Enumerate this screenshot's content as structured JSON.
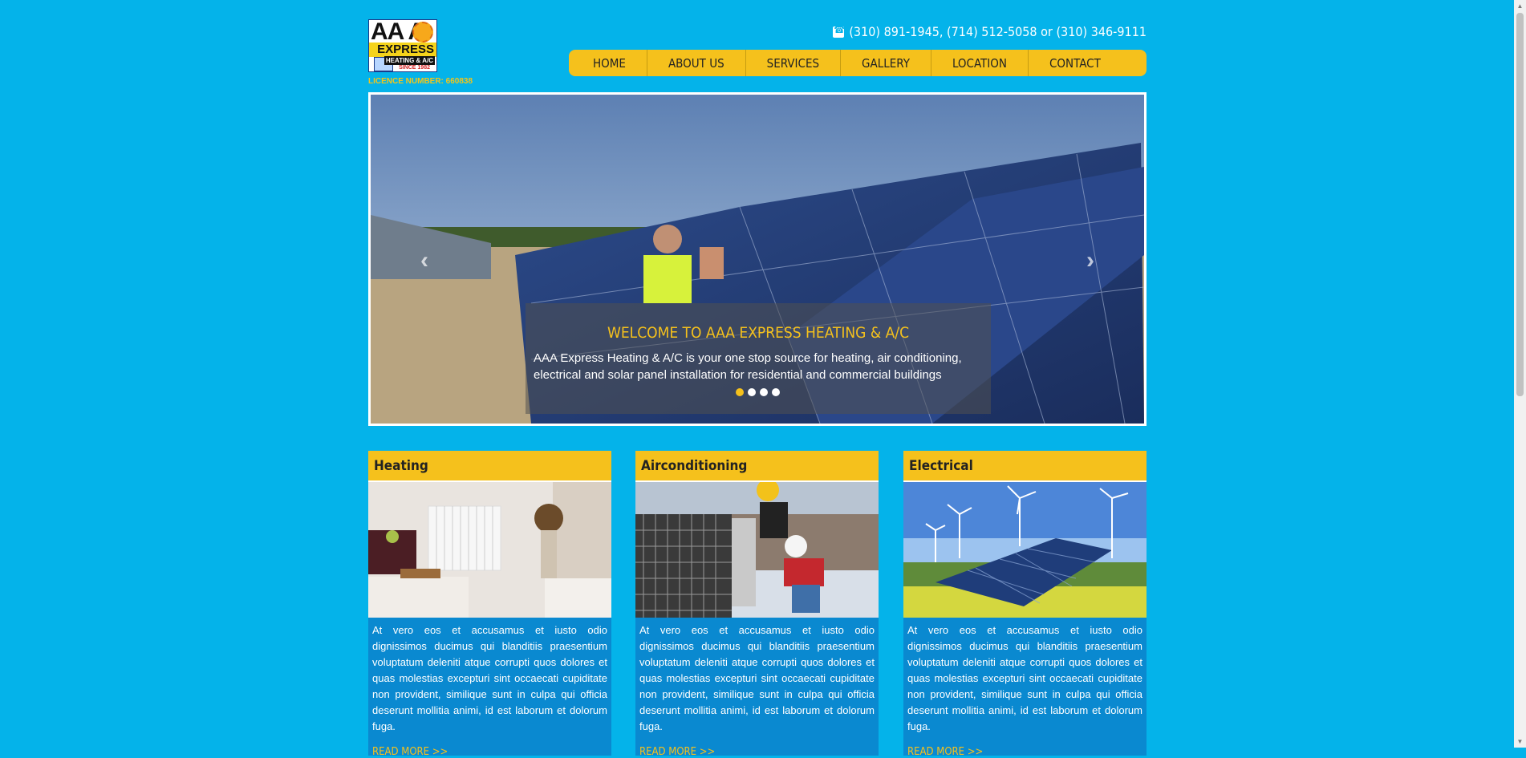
{
  "header": {
    "logo": {
      "text_aaa": "AA A",
      "text_express": "EXPRESS",
      "text_heating": "HEATING & A/C",
      "text_since": "SINCE 1982"
    },
    "licence": "LICENCE NUMBER: 660838",
    "phone": "(310) 891-1945, (714) 512-5058 or (310) 346-9111"
  },
  "nav": {
    "items": [
      "HOME",
      "ABOUT US",
      "SERVICES",
      "GALLERY",
      "LOCATION",
      "CONTACT"
    ]
  },
  "slider": {
    "title": "WELCOME TO AAA EXPRESS HEATING & A/C",
    "text": "AAA Express Heating & A/C is your one stop source for heating, air conditioning, electrical and solar panel installation for residential and commercial buildings",
    "prev": "‹",
    "next": "›",
    "dots": 4,
    "active_dot": 1
  },
  "cards": [
    {
      "title": "Heating",
      "text": "At vero eos et accusamus et iusto odio dignissimos ducimus qui blanditiis praesentium voluptatum deleniti atque corrupti quos dolores et quas molestias excepturi sint occaecati cupiditate non provident, similique sunt in culpa qui officia deserunt mollitia animi, id est laborum et dolorum fuga.",
      "read_more": "READ MORE >>"
    },
    {
      "title": "Airconditioning",
      "text": "At vero eos et accusamus et iusto odio dignissimos ducimus qui blanditiis praesentium voluptatum deleniti atque corrupti quos dolores et quas molestias excepturi sint occaecati cupiditate non provident, similique sunt in culpa qui officia deserunt mollitia animi, id est laborum et dolorum fuga.",
      "read_more": "READ MORE >>"
    },
    {
      "title": "Electrical",
      "text": "At vero eos et accusamus et iusto odio dignissimos ducimus qui blanditiis praesentium voluptatum deleniti atque corrupti quos dolores et quas molestias excepturi sint occaecati cupiditate non provident, similique sunt in culpa qui officia deserunt mollitia animi, id est laborum et dolorum fuga.",
      "read_more": "READ MORE >>"
    }
  ],
  "colors": {
    "background": "#04b3ea",
    "accent": "#f5c11c",
    "card": "#0a89d0"
  }
}
